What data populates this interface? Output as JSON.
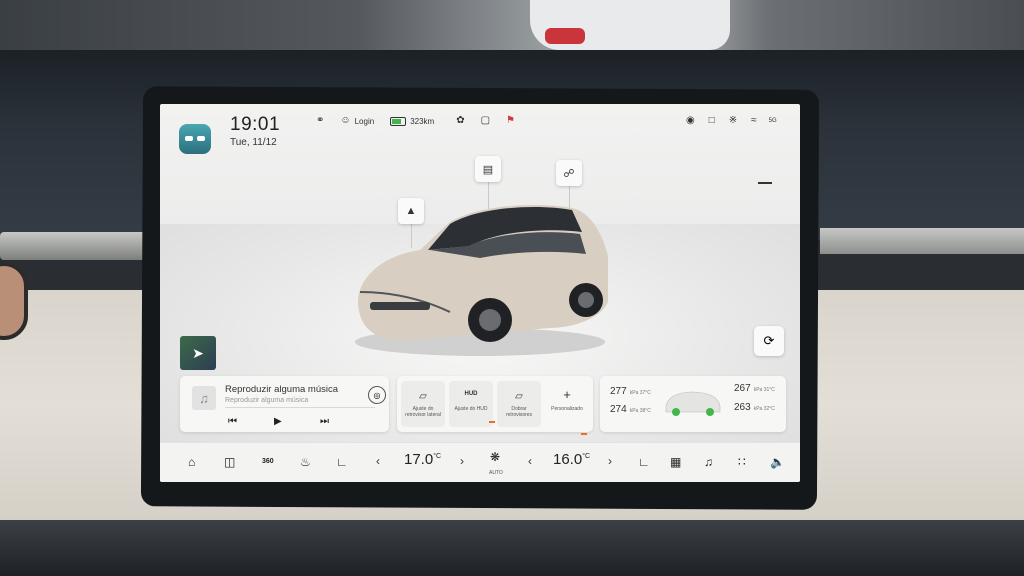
{
  "status": {
    "time": "19:01",
    "date": "Tue, 11/12",
    "login_label": "Login",
    "range": "323km",
    "signal_label": "5G"
  },
  "colors": {
    "battery_fill": "#42b64a",
    "accent_orange": "#e8702a",
    "app_icon": "#3a8f9e"
  },
  "icons": {
    "hotspots": [
      "headlight-icon",
      "side-mirror-icon",
      "charging-port-icon"
    ],
    "status": [
      "lock-icon",
      "user-icon",
      "battery-icon",
      "leaf-icon",
      "window-icon",
      "bell-icon",
      "location-icon",
      "phone-icon",
      "bluetooth-icon",
      "wifi-icon"
    ]
  },
  "music": {
    "title": "Reproduzir alguma música",
    "subtitle": "Reproduzir alguma música"
  },
  "adjust": {
    "items": [
      {
        "label": "Ajuste do retrovisor lateral",
        "icon": "mirror-icon"
      },
      {
        "label": "Ajuste do HUD",
        "icon": "hud-icon"
      },
      {
        "label": "Dobrar retrovisores",
        "icon": "fold-mirror-icon"
      },
      {
        "label": "Personalizado",
        "icon": "plus-icon"
      }
    ]
  },
  "tires": {
    "front_left": {
      "value": "277",
      "unit": "kPa 37°C"
    },
    "rear_left": {
      "value": "274",
      "unit": "kPa 38°C"
    },
    "front_right": {
      "value": "267",
      "unit": "kPa 31°C"
    },
    "rear_right": {
      "value": "263",
      "unit": "kPa 32°C"
    }
  },
  "climate": {
    "driver_temp": "17.0",
    "passenger_temp": "16.0",
    "unit": "°C",
    "fan_mode": "AUTO",
    "hud_short": "HUD",
    "view_360": "360"
  }
}
